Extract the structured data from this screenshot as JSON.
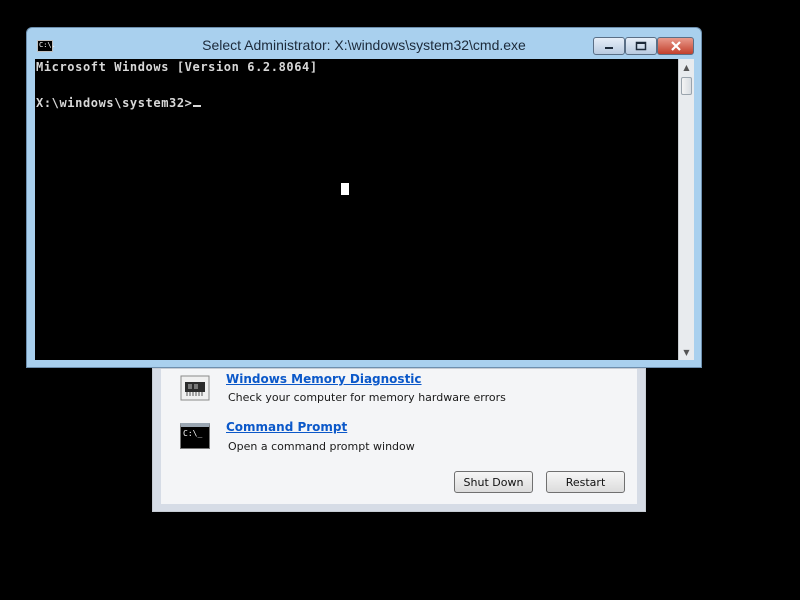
{
  "cmd_window": {
    "title": "Select Administrator: X:\\windows\\system32\\cmd.exe",
    "icon_text": "C:\\.",
    "console_lines": [
      "Microsoft Windows [Version 6.2.8064]",
      "",
      "X:\\windows\\system32>"
    ]
  },
  "recovery": {
    "options": [
      {
        "title": "Windows Memory Diagnostic",
        "description": "Check your computer for memory hardware errors",
        "icon": "memory-chip-icon"
      },
      {
        "title": "Command Prompt",
        "description": "Open a command prompt window",
        "icon": "command-prompt-icon",
        "icon_text": "C:\\_"
      }
    ],
    "shutdown_label": "Shut Down",
    "restart_label": "Restart"
  }
}
